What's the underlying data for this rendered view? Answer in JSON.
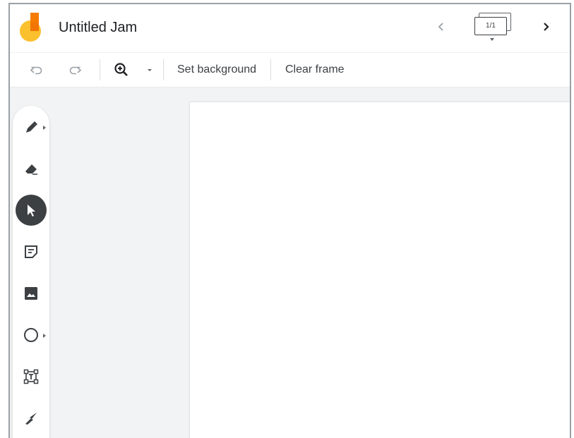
{
  "app": {
    "title": "Untitled Jam",
    "frame_counter": "1/1"
  },
  "toolbar": {
    "undo_icon": "undo-icon",
    "redo_icon": "redo-icon",
    "zoom_icon": "zoom-in-icon",
    "set_background_label": "Set background",
    "clear_frame_label": "Clear frame"
  },
  "palette": {
    "tools": [
      {
        "name": "pen",
        "icon": "pen-icon",
        "has_submenu": true
      },
      {
        "name": "eraser",
        "icon": "eraser-icon",
        "has_submenu": false
      },
      {
        "name": "select",
        "icon": "pointer-icon",
        "active": true
      },
      {
        "name": "sticky-note",
        "icon": "sticky-note-icon"
      },
      {
        "name": "image",
        "icon": "image-icon"
      },
      {
        "name": "shape",
        "icon": "circle-icon",
        "has_submenu": true
      },
      {
        "name": "text-box",
        "icon": "text-box-icon"
      },
      {
        "name": "laser",
        "icon": "laser-icon"
      }
    ]
  },
  "colors": {
    "logo_orange": "#f57c00",
    "logo_yellow": "#fbc02d",
    "active_tool": "#3c4043",
    "workspace_bg": "#f1f3f4"
  }
}
